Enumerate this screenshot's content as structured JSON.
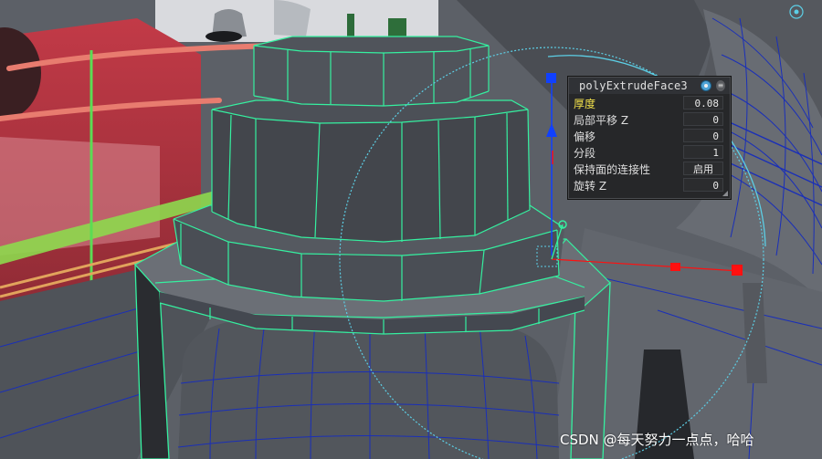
{
  "inview_editor": {
    "title": "polyExtrudeFace3",
    "rows": [
      {
        "label": "厚度",
        "value": "0.08",
        "highlight": true
      },
      {
        "label": "局部平移 Z",
        "value": "0"
      },
      {
        "label": "偏移",
        "value": "0"
      },
      {
        "label": "分段",
        "value": "1"
      },
      {
        "label": "保持面的连接性",
        "value": "启用"
      },
      {
        "label": "旋转 Z",
        "value": "0"
      }
    ]
  },
  "watermark": "CSDN @每天努力一点点，哈哈",
  "colors": {
    "selection_wire": "#35f0a0",
    "mesh_wire": "#1a2fb8",
    "manipulator_circle": "#5ccfe6",
    "manipulator_red": "#ff1010",
    "manipulator_blue": "#1040ff",
    "highlight_label": "#f2e14a"
  }
}
